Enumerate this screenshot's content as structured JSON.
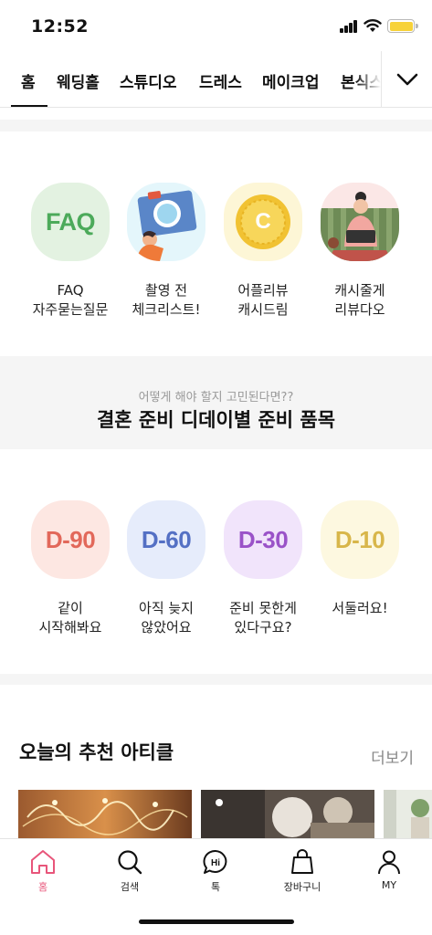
{
  "status_bar": {
    "time": "12:52"
  },
  "top_tabs": [
    {
      "label": "홈",
      "active": true
    },
    {
      "label": "웨딩홀"
    },
    {
      "label": "스튜디오"
    },
    {
      "label": "드레스"
    },
    {
      "label": "메이크업"
    },
    {
      "label": "본식스"
    }
  ],
  "menu_items": [
    {
      "icon_name": "faq-icon",
      "icon_text": "FAQ",
      "label": "FAQ\n자주묻는질문"
    },
    {
      "icon_name": "checklist-camera-icon",
      "label": "촬영 전\n체크리스트!"
    },
    {
      "icon_name": "cash-coin-icon",
      "icon_text": "C",
      "label": "어플리뷰\n캐시드림"
    },
    {
      "icon_name": "review-woman-icon",
      "label": "캐시줄게\n리뷰다오"
    }
  ],
  "dday_section": {
    "subtitle": "어떻게 해야 할지 고민된다면??",
    "title": "결혼 준비 디데이별 준비 품목",
    "items": [
      {
        "badge": "D-90",
        "label": "같이\n시작해봐요",
        "color": "#e2685a",
        "bg": "#fde7e2"
      },
      {
        "badge": "D-60",
        "label": "아직 늦지\n않았어요",
        "color": "#5470c4",
        "bg": "#e6ecfb"
      },
      {
        "badge": "D-30",
        "label": "준비 못한게\n있다구요?",
        "color": "#9a52c8",
        "bg": "#f1e4fb"
      },
      {
        "badge": "D-10",
        "label": "서둘러요!",
        "color": "#d8b64a",
        "bg": "#fdf8e0"
      }
    ]
  },
  "articles": {
    "title": "오늘의 추천 아티클",
    "more_label": "더보기"
  },
  "bottom_nav": [
    {
      "icon_name": "home-icon",
      "label": "홈",
      "active": true
    },
    {
      "icon_name": "search-icon",
      "label": "검색"
    },
    {
      "icon_name": "talk-icon",
      "icon_text": "Hi",
      "label": "톡"
    },
    {
      "icon_name": "shopping-bag-icon",
      "label": "장바구니"
    },
    {
      "icon_name": "user-icon",
      "label": "MY"
    }
  ],
  "colors": {
    "accent": "#e8557a",
    "band_gray": "#f5f5f5"
  }
}
